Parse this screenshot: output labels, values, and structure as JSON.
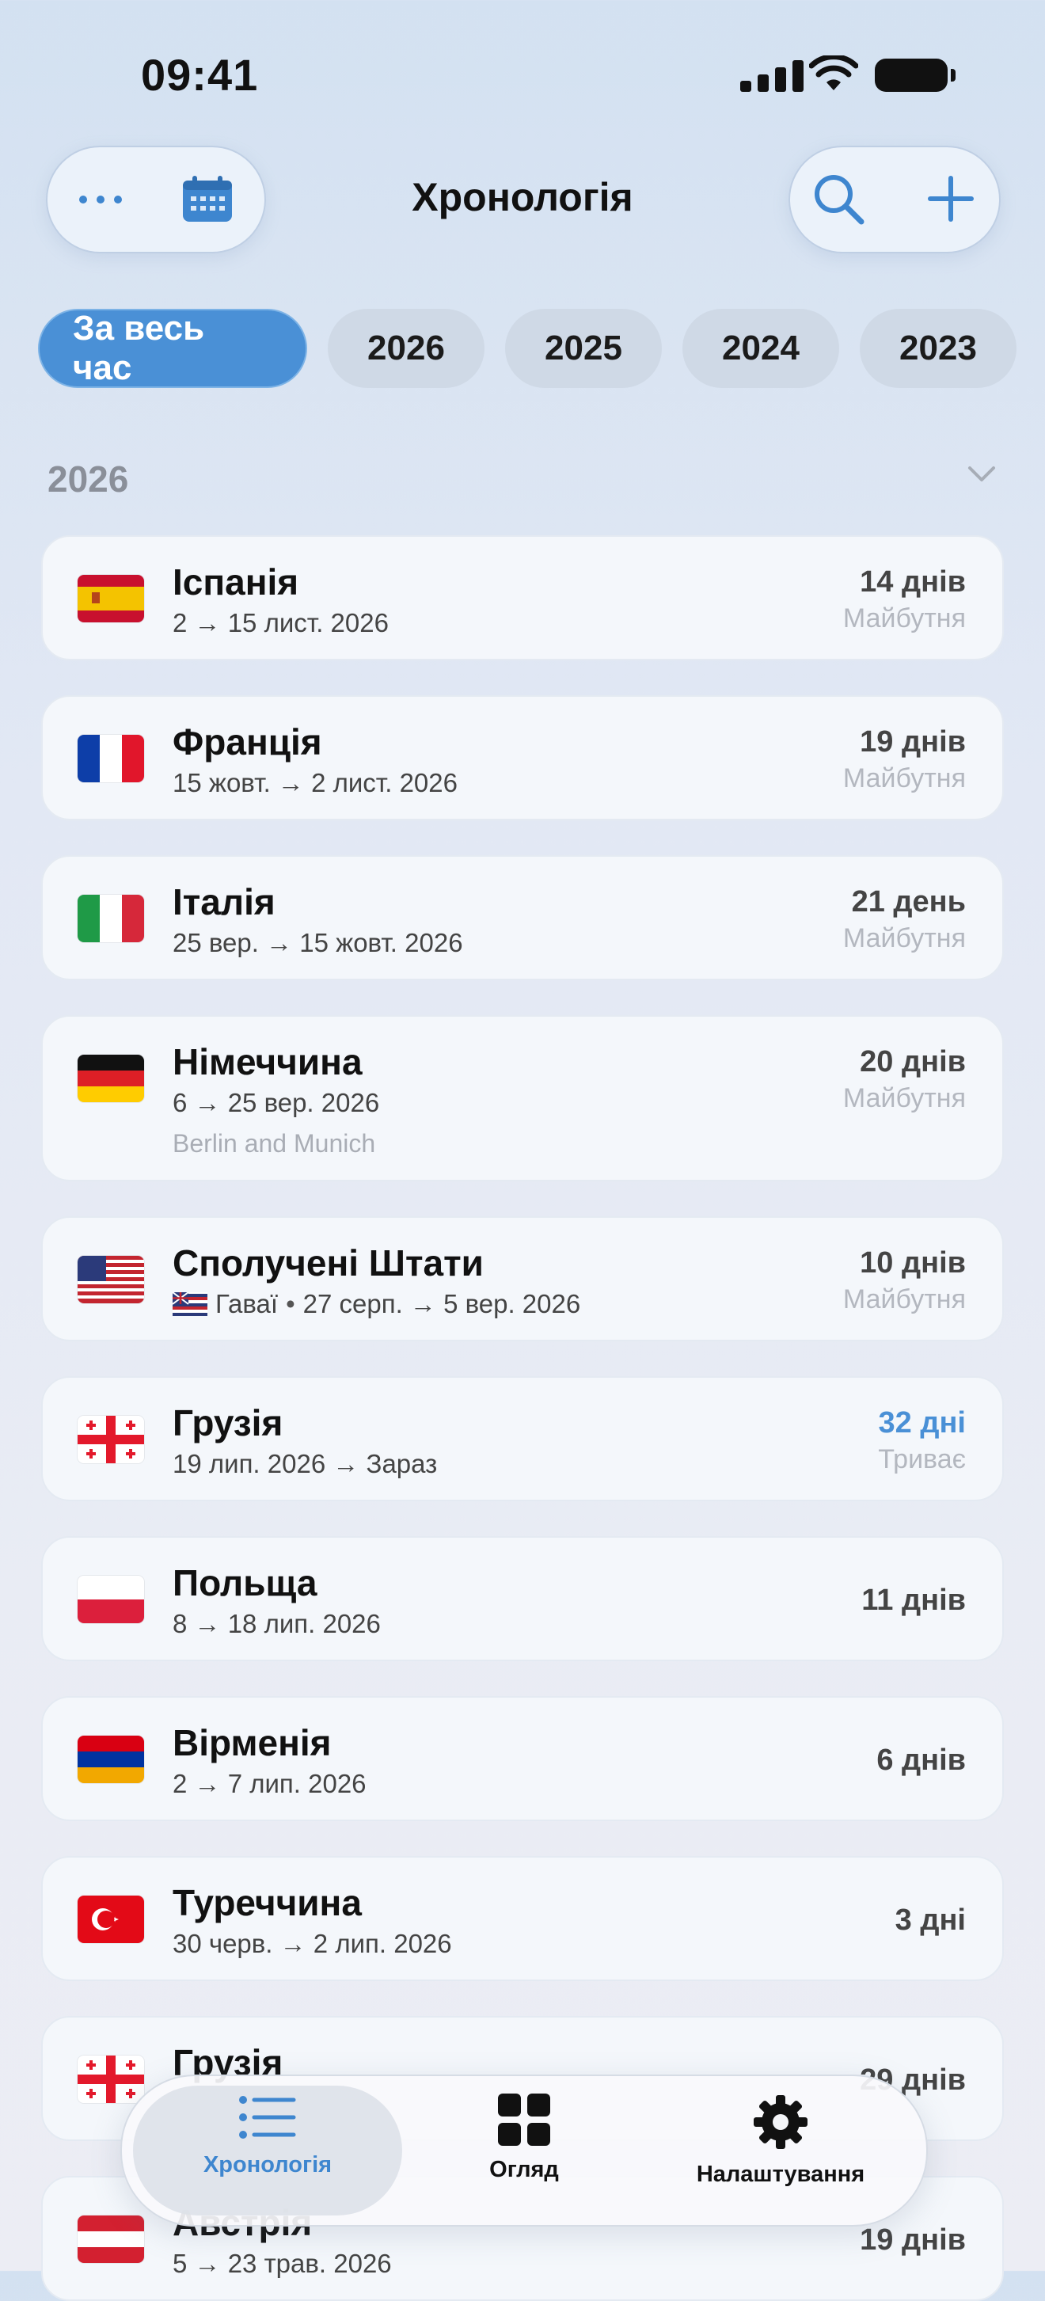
{
  "status_bar": {
    "time": "09:41"
  },
  "header": {
    "title": "Хронологія"
  },
  "filters": [
    {
      "label": "За весь час",
      "active": true
    },
    {
      "label": "2026",
      "active": false
    },
    {
      "label": "2025",
      "active": false
    },
    {
      "label": "2024",
      "active": false
    },
    {
      "label": "2023",
      "active": false
    }
  ],
  "section": {
    "year": "2026"
  },
  "trips": [
    {
      "flag": "es",
      "country": "Іспанія",
      "dates": "2 → 15 лист. 2026",
      "duration": "14 днів",
      "status": "Майбутня"
    },
    {
      "flag": "fr",
      "country": "Франція",
      "dates": "15 жовт. → 2 лист. 2026",
      "duration": "19 днів",
      "status": "Майбутня"
    },
    {
      "flag": "it",
      "country": "Італія",
      "dates": "25 вер. → 15 жовт. 2026",
      "duration": "21 день",
      "status": "Майбутня"
    },
    {
      "flag": "de",
      "country": "Німеччина",
      "dates": "6 → 25 вер. 2026",
      "note": "Berlin and Munich",
      "duration": "20 днів",
      "status": "Майбутня"
    },
    {
      "flag": "us",
      "country": "Сполучені Штати",
      "region": "Гаваї",
      "dates": "27 серп. → 5 вер. 2026",
      "duration": "10 днів",
      "status": "Майбутня"
    },
    {
      "flag": "ge",
      "country": "Грузія",
      "dates": "19 лип. 2026 → Зараз",
      "duration": "32 дні",
      "status": "Триває",
      "ongoing": true
    },
    {
      "flag": "pl",
      "country": "Польща",
      "dates": "8 → 18 лип. 2026",
      "duration": "11 днів"
    },
    {
      "flag": "am",
      "country": "Вірменія",
      "dates": "2 → 7 лип. 2026",
      "duration": "6 днів"
    },
    {
      "flag": "tr",
      "country": "Туреччина",
      "dates": "30 черв. → 2 лип. 2026",
      "duration": "3 дні"
    },
    {
      "flag": "ge",
      "country": "Грузія",
      "dates": "",
      "duration": "29 днів"
    },
    {
      "flag": "at",
      "country": "Австрія",
      "dates": "5 → 23 трав. 2026",
      "duration": "19 днів"
    }
  ],
  "tabbar": {
    "tabs": [
      {
        "label": "Хронологія",
        "icon": "list-icon",
        "active": true
      },
      {
        "label": "Огляд",
        "icon": "grid-icon",
        "active": false
      },
      {
        "label": "Налаштування",
        "icon": "gear-icon",
        "active": false
      }
    ]
  },
  "colors": {
    "accent": "#4a90d6",
    "background": "#e6ebf4",
    "card": "#f4f7fb"
  }
}
